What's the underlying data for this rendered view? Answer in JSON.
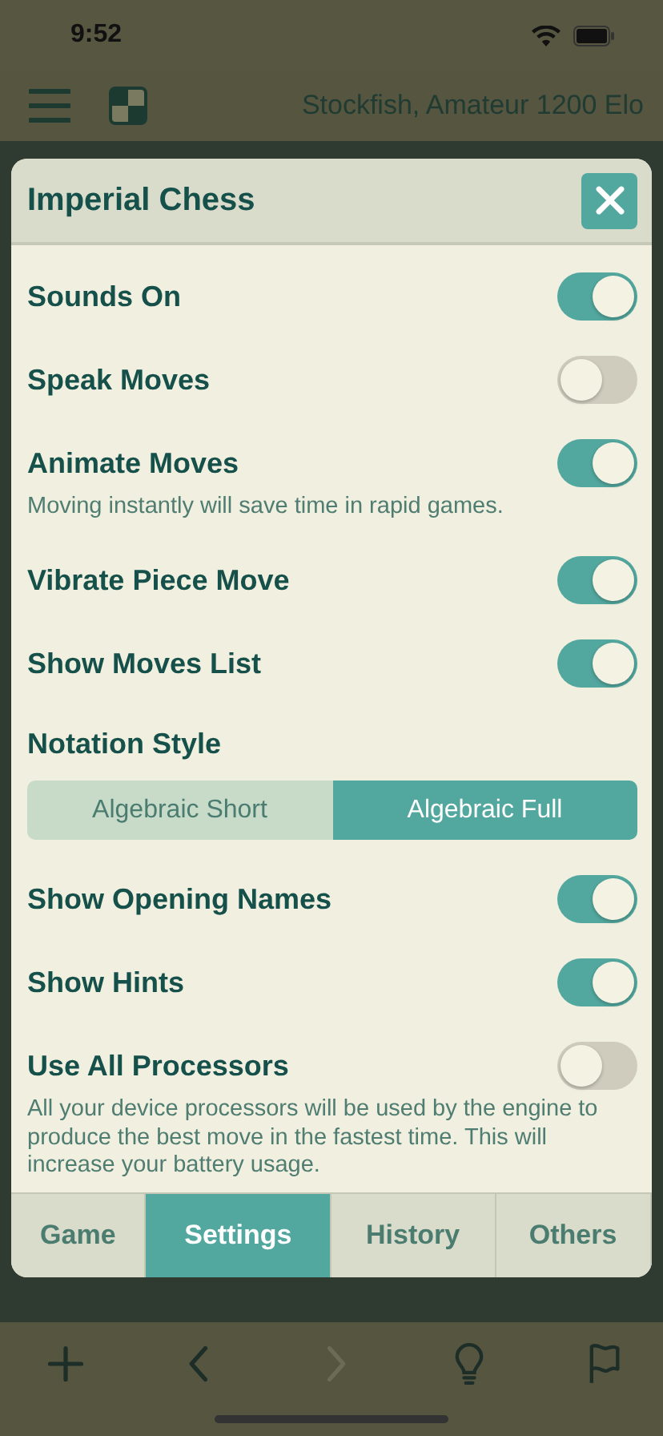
{
  "status_bar": {
    "time": "9:52"
  },
  "toolbar": {
    "engine": "Stockfish, Amateur 1200 Elo"
  },
  "dialog": {
    "title": "Imperial Chess",
    "settings": [
      {
        "kind": "toggle",
        "label": "Sounds On",
        "on": true
      },
      {
        "kind": "toggle",
        "label": "Speak Moves",
        "on": false
      },
      {
        "kind": "toggle",
        "label": "Animate Moves",
        "on": true,
        "note": "Moving instantly will save time in rapid games."
      },
      {
        "kind": "toggle",
        "label": "Vibrate Piece Move",
        "on": true
      },
      {
        "kind": "toggle",
        "label": "Show Moves List",
        "on": true
      },
      {
        "kind": "segmented",
        "label": "Notation Style",
        "options": [
          {
            "label": "Algebraic Short",
            "selected": false
          },
          {
            "label": "Algebraic Full",
            "selected": true
          }
        ]
      },
      {
        "kind": "toggle",
        "label": "Show Opening Names",
        "on": true
      },
      {
        "kind": "toggle",
        "label": "Show Hints",
        "on": true
      },
      {
        "kind": "toggle",
        "label": "Use All Processors",
        "on": false,
        "note": "All your device processors will be used by the engine to produce the best move in the fastest time. This will increase your battery usage."
      }
    ],
    "tabs": [
      {
        "label": "Game",
        "selected": false
      },
      {
        "label": "Settings",
        "selected": true
      },
      {
        "label": "History",
        "selected": false
      },
      {
        "label": "Others",
        "selected": false
      }
    ]
  },
  "bottom_toolbar": [
    {
      "kind": "plus",
      "disabled": false
    },
    {
      "kind": "back",
      "disabled": false
    },
    {
      "kind": "forward",
      "disabled": true
    },
    {
      "kind": "bulb",
      "disabled": false
    },
    {
      "kind": "flag",
      "disabled": false
    }
  ]
}
